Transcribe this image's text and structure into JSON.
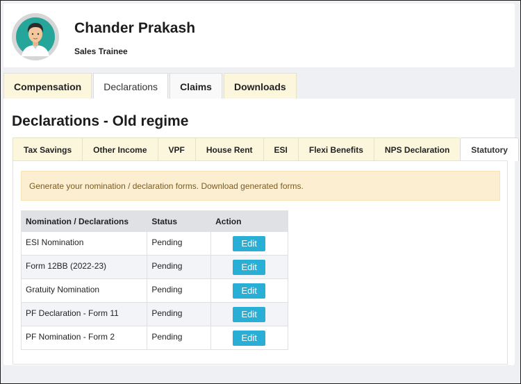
{
  "profile": {
    "name": "Chander Prakash",
    "role": "Sales Trainee"
  },
  "main_tabs": [
    {
      "label": "Compensation",
      "active": false
    },
    {
      "label": "Declarations",
      "active": true
    },
    {
      "label": "Claims",
      "active": false
    },
    {
      "label": "Downloads",
      "active": false
    }
  ],
  "page_title": "Declarations - Old regime",
  "sub_tabs": [
    {
      "label": "Tax Savings"
    },
    {
      "label": "Other Income"
    },
    {
      "label": "VPF"
    },
    {
      "label": "House Rent"
    },
    {
      "label": "ESI"
    },
    {
      "label": "Flexi Benefits"
    },
    {
      "label": "NPS Declaration"
    },
    {
      "label": "Statutory"
    }
  ],
  "active_sub_tab": "Statutory",
  "alert_text": "Generate your nomination / declaration forms. Download generated forms.",
  "table": {
    "headers": [
      "Nomination / Declarations",
      "Status",
      "Action"
    ],
    "rows": [
      {
        "name": "ESI Nomination",
        "status": "Pending",
        "action": "Edit"
      },
      {
        "name": "Form 12BB (2022-23)",
        "status": "Pending",
        "action": "Edit"
      },
      {
        "name": "Gratuity Nomination",
        "status": "Pending",
        "action": "Edit"
      },
      {
        "name": "PF Declaration - Form 11",
        "status": "Pending",
        "action": "Edit"
      },
      {
        "name": "PF Nomination - Form 2",
        "status": "Pending",
        "action": "Edit"
      }
    ]
  },
  "colors": {
    "tab_bg": "#fbf6dc",
    "alert_bg": "#fcefd1",
    "edit_button": "#29aed6",
    "table_header_bg": "#dfe1e5",
    "avatar_bg": "#26a69a"
  },
  "icons": {
    "avatar": "user-avatar-icon"
  }
}
